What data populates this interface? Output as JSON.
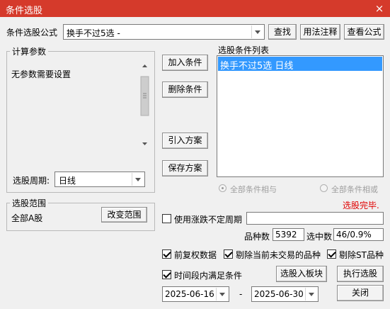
{
  "window": {
    "title": "条件选股",
    "close_glyph": "×"
  },
  "formula": {
    "label": "条件选股公式",
    "value": "换手不过5选  -",
    "find_button": "查找",
    "usage_button": "用法注释",
    "view_button": "查看公式"
  },
  "params": {
    "group_label": "计算参数",
    "message": "无参数需要设置",
    "period_label": "选股周期:",
    "period_value": "日线"
  },
  "actions": {
    "add": "加入条件",
    "delete": "删除条件",
    "import": "引入方案",
    "save": "保存方案"
  },
  "conditions": {
    "title": "选股条件列表",
    "items": [
      "换手不过5选  日线"
    ],
    "and_label": "全部条件相与",
    "or_label": "全部条件相或"
  },
  "status": {
    "text": "选股完毕.",
    "color": "#e00000"
  },
  "range": {
    "group_label": "选股范围",
    "value": "全部A股",
    "change_button": "改变范围"
  },
  "options": {
    "uncertain_period_label": "使用涨跌不定周期",
    "uncertain_period_checked": false,
    "count_label": "品种数",
    "count_value": "5392",
    "selected_label": "选中数",
    "selected_value": "46/0.9%",
    "adjust_label": "前复权数据",
    "adjust_checked": true,
    "exclude_nontrading_label": "剔除当前未交易的品种",
    "exclude_nontrading_checked": true,
    "exclude_st_label": "剔除ST品种",
    "exclude_st_checked": true,
    "time_range_label": "时间段内满足条件",
    "time_range_checked": true,
    "to_block_button": "选股入板块",
    "execute_button": "执行选股",
    "start_date": "2025-06-16",
    "date_separator": "-",
    "end_date": "2025-06-30",
    "close_button": "关闭"
  },
  "colors": {
    "title_bar": "#d53a2b",
    "selection": "#3399ff"
  }
}
